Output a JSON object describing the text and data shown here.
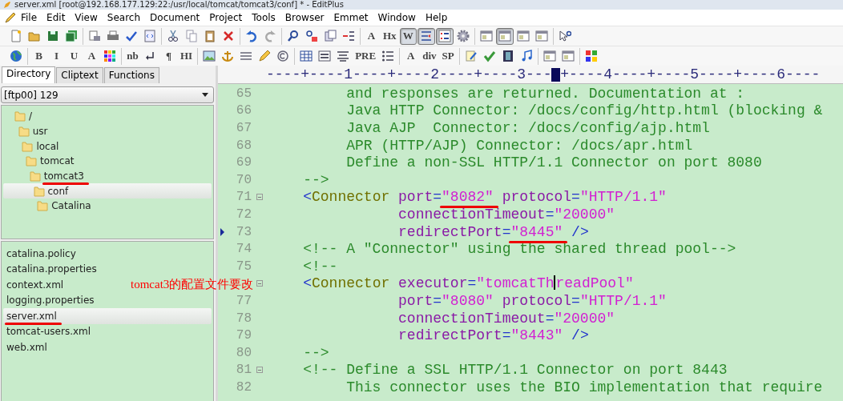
{
  "window": {
    "title": "server.xml [root@192.168.177.129:22:/usr/local/tomcat/tomcat3/conf] * - EditPlus"
  },
  "menu": [
    "File",
    "Edit",
    "View",
    "Search",
    "Document",
    "Project",
    "Tools",
    "Browser",
    "Emmet",
    "Window",
    "Help"
  ],
  "toolbar_1": [
    [
      {
        "kind": "new",
        "pressed": false
      },
      {
        "kind": "open",
        "pressed": false
      },
      {
        "kind": "save",
        "pressed": false
      },
      {
        "kind": "saveall",
        "pressed": false
      }
    ],
    [
      {
        "kind": "preview",
        "pressed": false
      },
      {
        "kind": "print",
        "pressed": false
      },
      {
        "kind": "spell",
        "pressed": false
      },
      {
        "kind": "browser",
        "pressed": false
      }
    ],
    [
      {
        "kind": "cut",
        "pressed": false
      },
      {
        "kind": "copy",
        "pressed": false
      },
      {
        "kind": "paste",
        "pressed": false
      },
      {
        "kind": "delete",
        "pressed": false
      }
    ],
    [
      {
        "kind": "undo",
        "pressed": false
      },
      {
        "kind": "redo",
        "pressed": false
      }
    ],
    [
      {
        "kind": "find",
        "pressed": false
      },
      {
        "kind": "replace",
        "pressed": false
      },
      {
        "kind": "findfiles",
        "pressed": false
      },
      {
        "kind": "gotoline",
        "pressed": false
      }
    ],
    [
      {
        "kind": "text",
        "label": "A",
        "pressed": false
      },
      {
        "kind": "text",
        "label": "Hx",
        "pressed": false
      },
      {
        "kind": "text",
        "label": "W",
        "pressed": true
      },
      {
        "kind": "wrap",
        "pressed": true
      },
      {
        "kind": "linenum",
        "pressed": true
      },
      {
        "kind": "gear",
        "pressed": false
      }
    ],
    [
      {
        "kind": "panel",
        "pressed": false
      },
      {
        "kind": "panel",
        "pressed": true
      },
      {
        "kind": "panel",
        "pressed": false
      },
      {
        "kind": "panel",
        "pressed": false
      }
    ],
    [
      {
        "kind": "help",
        "pressed": false
      }
    ]
  ],
  "toolbar_2": [
    [
      {
        "kind": "globe",
        "pressed": false
      }
    ],
    [
      {
        "kind": "text",
        "label": "B",
        "pressed": false
      },
      {
        "kind": "text",
        "label": "I",
        "pressed": false
      },
      {
        "kind": "text",
        "label": "U",
        "pressed": false
      },
      {
        "kind": "text",
        "label": "A",
        "pressed": false
      },
      {
        "kind": "palette",
        "pressed": false
      }
    ],
    [
      {
        "kind": "text",
        "label": "nb",
        "pressed": false
      },
      {
        "kind": "enter",
        "pressed": false
      },
      {
        "kind": "text",
        "label": "¶",
        "pressed": false
      },
      {
        "kind": "text",
        "label": "HI",
        "pressed": false
      }
    ],
    [
      {
        "kind": "image",
        "pressed": false
      },
      {
        "kind": "anchor",
        "pressed": false
      },
      {
        "kind": "lines",
        "pressed": false
      },
      {
        "kind": "pencil",
        "pressed": false
      },
      {
        "kind": "copyright",
        "pressed": false
      }
    ],
    [
      {
        "kind": "table",
        "pressed": false
      },
      {
        "kind": "form",
        "pressed": false
      },
      {
        "kind": "align",
        "pressed": false
      },
      {
        "kind": "text",
        "label": "PRE",
        "pressed": false
      },
      {
        "kind": "list",
        "pressed": false
      }
    ],
    [
      {
        "kind": "text",
        "label": "A",
        "pressed": false
      },
      {
        "kind": "text",
        "label": "div",
        "pressed": false
      },
      {
        "kind": "text",
        "label": "SP",
        "pressed": false
      }
    ],
    [
      {
        "kind": "edit",
        "pressed": false
      },
      {
        "kind": "check",
        "pressed": false
      },
      {
        "kind": "film",
        "pressed": false
      },
      {
        "kind": "music",
        "pressed": false
      }
    ],
    [
      {
        "kind": "panel",
        "pressed": false
      },
      {
        "kind": "panel",
        "pressed": false
      }
    ],
    [
      {
        "kind": "grid",
        "pressed": false
      }
    ]
  ],
  "sidebar": {
    "tabs": [
      {
        "label": "Directory",
        "selected": true
      },
      {
        "label": "Cliptext",
        "selected": false
      },
      {
        "label": "Functions",
        "selected": false
      }
    ],
    "drive": "[ftp00] 129",
    "tree": [
      {
        "label": "/",
        "selected": false,
        "underlined": false,
        "children": [
          {
            "label": "usr",
            "selected": false,
            "underlined": false,
            "children": [
              {
                "label": "local",
                "selected": false,
                "underlined": false,
                "children": [
                  {
                    "label": "tomcat",
                    "selected": false,
                    "underlined": false,
                    "children": [
                      {
                        "label": "tomcat3",
                        "selected": false,
                        "underlined": true,
                        "children": [
                          {
                            "label": "conf",
                            "selected": true,
                            "underlined": false,
                            "children": [
                              {
                                "label": "Catalina",
                                "selected": false,
                                "underlined": false
                              }
                            ]
                          }
                        ]
                      }
                    ]
                  }
                ]
              }
            ]
          }
        ]
      }
    ],
    "files": [
      {
        "label": "catalina.policy",
        "selected": false,
        "underlined": false
      },
      {
        "label": "catalina.properties",
        "selected": false,
        "underlined": false
      },
      {
        "label": "context.xml",
        "selected": false,
        "underlined": false
      },
      {
        "label": "logging.properties",
        "selected": false,
        "underlined": false
      },
      {
        "label": "server.xml",
        "selected": true,
        "underlined": true
      },
      {
        "label": "tomcat-users.xml",
        "selected": false,
        "underlined": false
      },
      {
        "label": "web.xml",
        "selected": false,
        "underlined": false
      }
    ]
  },
  "editor": {
    "ruler_before": "----+----1----+----2----+----3---",
    "ruler_after": "+----4----+----5----+----6----",
    "lines": [
      {
        "number": "65",
        "fold": false,
        "marker": false,
        "tokens": [
          {
            "kind": "comment",
            "text": "         and responses are returned. Documentation at :"
          }
        ]
      },
      {
        "number": "66",
        "fold": false,
        "marker": false,
        "tokens": [
          {
            "kind": "comment",
            "text": "         Java HTTP Connector: /docs/config/http.html (blocking &"
          }
        ]
      },
      {
        "number": "67",
        "fold": false,
        "marker": false,
        "tokens": [
          {
            "kind": "comment",
            "text": "         Java AJP  Connector: /docs/config/ajp.html"
          }
        ]
      },
      {
        "number": "68",
        "fold": false,
        "marker": false,
        "tokens": [
          {
            "kind": "comment",
            "text": "         APR (HTTP/AJP) Connector: /docs/apr.html"
          }
        ]
      },
      {
        "number": "69",
        "fold": false,
        "marker": false,
        "tokens": [
          {
            "kind": "comment",
            "text": "         Define a non-SSL HTTP/1.1 Connector on port 8080"
          }
        ]
      },
      {
        "number": "70",
        "fold": false,
        "marker": false,
        "tokens": [
          {
            "kind": "comment",
            "text": "    -->"
          }
        ]
      },
      {
        "number": "71",
        "fold": true,
        "marker": false,
        "tokens": [
          {
            "kind": "bracket",
            "text": "    <"
          },
          {
            "kind": "tag",
            "text": "Connector"
          },
          {
            "kind": "attr",
            "text": " port"
          },
          {
            "kind": "punct",
            "text": "="
          },
          {
            "kind": "value",
            "text": "\"8082\"",
            "underlined": true
          },
          {
            "kind": "attr",
            "text": " protocol"
          },
          {
            "kind": "punct",
            "text": "="
          },
          {
            "kind": "value",
            "text": "\"HTTP/1.1\"",
            "underlined": false
          }
        ]
      },
      {
        "number": "72",
        "fold": false,
        "marker": false,
        "tokens": [
          {
            "kind": "attr",
            "text": "               connectionTimeout"
          },
          {
            "kind": "punct",
            "text": "="
          },
          {
            "kind": "value",
            "text": "\"20000\"",
            "underlined": false
          }
        ]
      },
      {
        "number": "73",
        "fold": false,
        "marker": true,
        "tokens": [
          {
            "kind": "attr",
            "text": "               redirectPort"
          },
          {
            "kind": "punct",
            "text": "="
          },
          {
            "kind": "value",
            "text": "\"8445\"",
            "underlined": true
          },
          {
            "kind": "punct",
            "text": " />"
          }
        ]
      },
      {
        "number": "74",
        "fold": false,
        "marker": false,
        "tokens": [
          {
            "kind": "comment",
            "text": "    <!-- A \"Connector\" using the shared thread pool-->"
          }
        ]
      },
      {
        "number": "75",
        "fold": false,
        "marker": false,
        "tokens": [
          {
            "kind": "comment",
            "text": "    <!--"
          }
        ]
      },
      {
        "fold": true,
        "marker": false,
        "tokens": [
          {
            "kind": "bracket",
            "text": "    <"
          },
          {
            "kind": "tag",
            "text": "Connector"
          },
          {
            "kind": "attr",
            "text": " executor"
          },
          {
            "kind": "punct",
            "text": "="
          },
          {
            "kind": "value",
            "text": "\"tomcatTh",
            "underlined": false
          },
          {
            "kind": "caret"
          },
          {
            "kind": "value",
            "text": "readPool\"",
            "underlined": false
          }
        ]
      },
      {
        "number": "77",
        "fold": false,
        "marker": false,
        "tokens": [
          {
            "kind": "attr",
            "text": "               port"
          },
          {
            "kind": "punct",
            "text": "="
          },
          {
            "kind": "value",
            "text": "\"8080\"",
            "underlined": false
          },
          {
            "kind": "attr",
            "text": " protocol"
          },
          {
            "kind": "punct",
            "text": "="
          },
          {
            "kind": "value",
            "text": "\"HTTP/1.1\"",
            "underlined": false
          }
        ]
      },
      {
        "number": "78",
        "fold": false,
        "marker": false,
        "tokens": [
          {
            "kind": "attr",
            "text": "               connectionTimeout"
          },
          {
            "kind": "punct",
            "text": "="
          },
          {
            "kind": "value",
            "text": "\"20000\"",
            "underlined": false
          }
        ]
      },
      {
        "number": "79",
        "fold": false,
        "marker": false,
        "tokens": [
          {
            "kind": "attr",
            "text": "               redirectPort"
          },
          {
            "kind": "punct",
            "text": "="
          },
          {
            "kind": "value",
            "text": "\"8443\"",
            "underlined": false
          },
          {
            "kind": "punct",
            "text": " />"
          }
        ]
      },
      {
        "number": "80",
        "fold": false,
        "marker": false,
        "tokens": [
          {
            "kind": "comment",
            "text": "    -->"
          }
        ]
      },
      {
        "number": "81",
        "fold": true,
        "marker": false,
        "tokens": [
          {
            "kind": "comment",
            "text": "    <!-- Define a SSL HTTP/1.1 Connector on port 8443"
          }
        ]
      },
      {
        "number": "82",
        "fold": false,
        "marker": false,
        "tokens": [
          {
            "kind": "comment",
            "text": "         This connector uses the BIO implementation that require"
          }
        ]
      }
    ]
  },
  "annotation": "tomcat3的配置文件要改"
}
